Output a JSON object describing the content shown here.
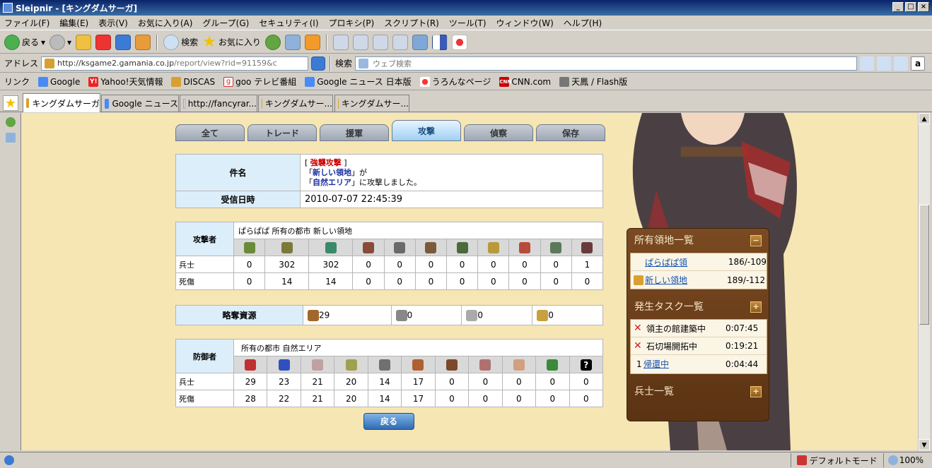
{
  "window": {
    "title": "Sleipnir - [キングダムサーガ]"
  },
  "menu": [
    "ファイル(F)",
    "編集(E)",
    "表示(V)",
    "お気に入り(A)",
    "グループ(G)",
    "セキュリティ(I)",
    "プロキシ(P)",
    "スクリプト(R)",
    "ツール(T)",
    "ウィンドウ(W)",
    "ヘルプ(H)"
  ],
  "toolbar": {
    "back": "戻る",
    "search": "検索",
    "favorites": "お気に入り"
  },
  "address": {
    "label": "アドレス",
    "url_host": "http://ksgame2.gamania.co.jp",
    "url_path": "/report/view?rid=91159&c",
    "search_label": "検索",
    "search_placeholder": "ウェブ検索"
  },
  "links": {
    "label": "リンク",
    "items": [
      "Google",
      "Yahoo!天気情報",
      "DISCAS",
      "goo テレビ番組",
      "Google ニュース 日本版",
      "うろんなページ",
      "CNN.com",
      "天鳳 / Flash版"
    ]
  },
  "tabs": [
    "キングダムサーガ",
    "Google ニュース",
    "http://fancyrar...",
    "キングダムサー...",
    "キングダムサー..."
  ],
  "report": {
    "category_tabs": [
      "全て",
      "トレード",
      "援軍",
      "攻撃",
      "偵察",
      "保存"
    ],
    "active_tab": "攻撃",
    "subject_label": "件名",
    "subject_bracket_l": "[",
    "subject_tag": "強襲攻撃",
    "subject_bracket_r": "]",
    "subject_q1": "「",
    "subject_from": "新しい領地",
    "subject_q1_end": "」が",
    "subject_q2": "「",
    "subject_to": "自然エリア",
    "subject_q2_end": "」に攻撃しました。",
    "received_label": "受信日時",
    "received_value": "2010-07-07 22:45:39",
    "attacker": {
      "label": "攻撃者",
      "owner": "ぱらぱぱ 所有の都市 新しい領地",
      "soldiers_label": "兵士",
      "casualties_label": "死傷",
      "soldiers": [
        "0",
        "302",
        "302",
        "0",
        "0",
        "0",
        "0",
        "0",
        "0",
        "0",
        "1"
      ],
      "casualties": [
        "0",
        "14",
        "14",
        "0",
        "0",
        "0",
        "0",
        "0",
        "0",
        "0",
        "0"
      ]
    },
    "loot": {
      "label": "略奪資源",
      "values": [
        "29",
        "0",
        "0",
        "0"
      ]
    },
    "defender": {
      "label": "防御者",
      "owner": "所有の都市 自然エリア",
      "soldiers_label": "兵士",
      "casualties_label": "死傷",
      "soldiers": [
        "29",
        "23",
        "21",
        "20",
        "14",
        "17",
        "0",
        "0",
        "0",
        "0",
        "0"
      ],
      "casualties": [
        "28",
        "22",
        "21",
        "20",
        "14",
        "17",
        "0",
        "0",
        "0",
        "0",
        "0"
      ]
    },
    "back_button": "戻る"
  },
  "side_panel": {
    "territories_title": "所有領地一覧",
    "territories": [
      {
        "name": "ぱらぱぱ領",
        "coords": "186/-109"
      },
      {
        "name": "新しい領地",
        "coords": "189/-112"
      }
    ],
    "tasks_title": "発生タスク一覧",
    "tasks": [
      {
        "prefix": "",
        "name": "領主の館建築中",
        "time": "0:07:45"
      },
      {
        "prefix": "",
        "name": "石切場開拓中",
        "time": "0:19:21"
      },
      {
        "prefix": "1",
        "name": "帰還中",
        "time": "0:04:44"
      }
    ],
    "soldiers_title": "兵士一覧"
  },
  "status": {
    "mode": "デフォルトモード",
    "zoom": "100%"
  }
}
